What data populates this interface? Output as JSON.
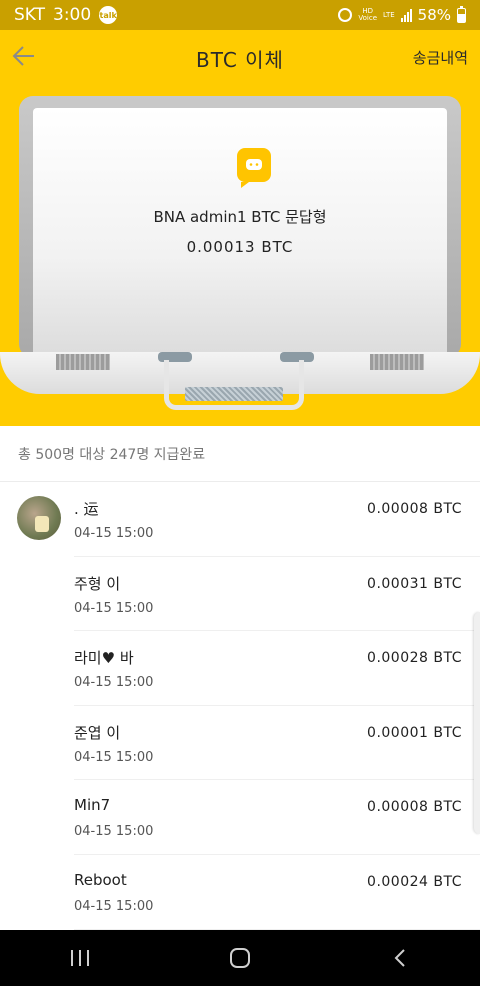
{
  "status": {
    "carrier": "SKT",
    "time": "3:00",
    "talk_badge": "talk",
    "volte": "HD\nVoice",
    "network": "LTE",
    "battery": "58%"
  },
  "header": {
    "title": "BTC 이체",
    "history_label": "송금내역",
    "back_icon": "arrow-left-icon"
  },
  "bundle": {
    "name": "BNA admin1 BTC 문답형",
    "amount": "0.00013 BTC"
  },
  "summary": "총 500명 대상 247명 지급완료",
  "recipients": [
    {
      "name": ". 运",
      "time": "04-15 15:00",
      "amount": "0.00008 BTC"
    },
    {
      "name": "주형 이",
      "time": "04-15 15:00",
      "amount": "0.00031 BTC"
    },
    {
      "name": "라미♥ 바",
      "time": "04-15 15:00",
      "amount": "0.00028 BTC"
    },
    {
      "name": "준엽 이",
      "time": "04-15 15:00",
      "amount": "0.00001 BTC"
    },
    {
      "name": "Min7",
      "time": "04-15 15:00",
      "amount": "0.00008 BTC"
    },
    {
      "name": "Reboot",
      "time": "04-15 15:00",
      "amount": "0.00024 BTC"
    }
  ],
  "colors": {
    "brand_yellow": "#ffcc00",
    "status_bar": "#c9a000",
    "nav_bar": "#000000"
  }
}
